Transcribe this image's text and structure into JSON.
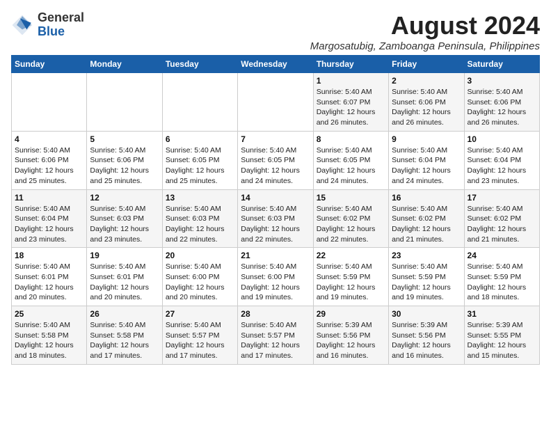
{
  "logo": {
    "general": "General",
    "blue": "Blue"
  },
  "title": "August 2024",
  "subtitle": "Margosatubig, Zamboanga Peninsula, Philippines",
  "days_of_week": [
    "Sunday",
    "Monday",
    "Tuesday",
    "Wednesday",
    "Thursday",
    "Friday",
    "Saturday"
  ],
  "weeks": [
    [
      {
        "day": "",
        "info": ""
      },
      {
        "day": "",
        "info": ""
      },
      {
        "day": "",
        "info": ""
      },
      {
        "day": "",
        "info": ""
      },
      {
        "day": "1",
        "info": "Sunrise: 5:40 AM\nSunset: 6:07 PM\nDaylight: 12 hours\nand 26 minutes."
      },
      {
        "day": "2",
        "info": "Sunrise: 5:40 AM\nSunset: 6:06 PM\nDaylight: 12 hours\nand 26 minutes."
      },
      {
        "day": "3",
        "info": "Sunrise: 5:40 AM\nSunset: 6:06 PM\nDaylight: 12 hours\nand 26 minutes."
      }
    ],
    [
      {
        "day": "4",
        "info": "Sunrise: 5:40 AM\nSunset: 6:06 PM\nDaylight: 12 hours\nand 25 minutes."
      },
      {
        "day": "5",
        "info": "Sunrise: 5:40 AM\nSunset: 6:06 PM\nDaylight: 12 hours\nand 25 minutes."
      },
      {
        "day": "6",
        "info": "Sunrise: 5:40 AM\nSunset: 6:05 PM\nDaylight: 12 hours\nand 25 minutes."
      },
      {
        "day": "7",
        "info": "Sunrise: 5:40 AM\nSunset: 6:05 PM\nDaylight: 12 hours\nand 24 minutes."
      },
      {
        "day": "8",
        "info": "Sunrise: 5:40 AM\nSunset: 6:05 PM\nDaylight: 12 hours\nand 24 minutes."
      },
      {
        "day": "9",
        "info": "Sunrise: 5:40 AM\nSunset: 6:04 PM\nDaylight: 12 hours\nand 24 minutes."
      },
      {
        "day": "10",
        "info": "Sunrise: 5:40 AM\nSunset: 6:04 PM\nDaylight: 12 hours\nand 23 minutes."
      }
    ],
    [
      {
        "day": "11",
        "info": "Sunrise: 5:40 AM\nSunset: 6:04 PM\nDaylight: 12 hours\nand 23 minutes."
      },
      {
        "day": "12",
        "info": "Sunrise: 5:40 AM\nSunset: 6:03 PM\nDaylight: 12 hours\nand 23 minutes."
      },
      {
        "day": "13",
        "info": "Sunrise: 5:40 AM\nSunset: 6:03 PM\nDaylight: 12 hours\nand 22 minutes."
      },
      {
        "day": "14",
        "info": "Sunrise: 5:40 AM\nSunset: 6:03 PM\nDaylight: 12 hours\nand 22 minutes."
      },
      {
        "day": "15",
        "info": "Sunrise: 5:40 AM\nSunset: 6:02 PM\nDaylight: 12 hours\nand 22 minutes."
      },
      {
        "day": "16",
        "info": "Sunrise: 5:40 AM\nSunset: 6:02 PM\nDaylight: 12 hours\nand 21 minutes."
      },
      {
        "day": "17",
        "info": "Sunrise: 5:40 AM\nSunset: 6:02 PM\nDaylight: 12 hours\nand 21 minutes."
      }
    ],
    [
      {
        "day": "18",
        "info": "Sunrise: 5:40 AM\nSunset: 6:01 PM\nDaylight: 12 hours\nand 20 minutes."
      },
      {
        "day": "19",
        "info": "Sunrise: 5:40 AM\nSunset: 6:01 PM\nDaylight: 12 hours\nand 20 minutes."
      },
      {
        "day": "20",
        "info": "Sunrise: 5:40 AM\nSunset: 6:00 PM\nDaylight: 12 hours\nand 20 minutes."
      },
      {
        "day": "21",
        "info": "Sunrise: 5:40 AM\nSunset: 6:00 PM\nDaylight: 12 hours\nand 19 minutes."
      },
      {
        "day": "22",
        "info": "Sunrise: 5:40 AM\nSunset: 5:59 PM\nDaylight: 12 hours\nand 19 minutes."
      },
      {
        "day": "23",
        "info": "Sunrise: 5:40 AM\nSunset: 5:59 PM\nDaylight: 12 hours\nand 19 minutes."
      },
      {
        "day": "24",
        "info": "Sunrise: 5:40 AM\nSunset: 5:59 PM\nDaylight: 12 hours\nand 18 minutes."
      }
    ],
    [
      {
        "day": "25",
        "info": "Sunrise: 5:40 AM\nSunset: 5:58 PM\nDaylight: 12 hours\nand 18 minutes."
      },
      {
        "day": "26",
        "info": "Sunrise: 5:40 AM\nSunset: 5:58 PM\nDaylight: 12 hours\nand 17 minutes."
      },
      {
        "day": "27",
        "info": "Sunrise: 5:40 AM\nSunset: 5:57 PM\nDaylight: 12 hours\nand 17 minutes."
      },
      {
        "day": "28",
        "info": "Sunrise: 5:40 AM\nSunset: 5:57 PM\nDaylight: 12 hours\nand 17 minutes."
      },
      {
        "day": "29",
        "info": "Sunrise: 5:39 AM\nSunset: 5:56 PM\nDaylight: 12 hours\nand 16 minutes."
      },
      {
        "day": "30",
        "info": "Sunrise: 5:39 AM\nSunset: 5:56 PM\nDaylight: 12 hours\nand 16 minutes."
      },
      {
        "day": "31",
        "info": "Sunrise: 5:39 AM\nSunset: 5:55 PM\nDaylight: 12 hours\nand 15 minutes."
      }
    ]
  ]
}
